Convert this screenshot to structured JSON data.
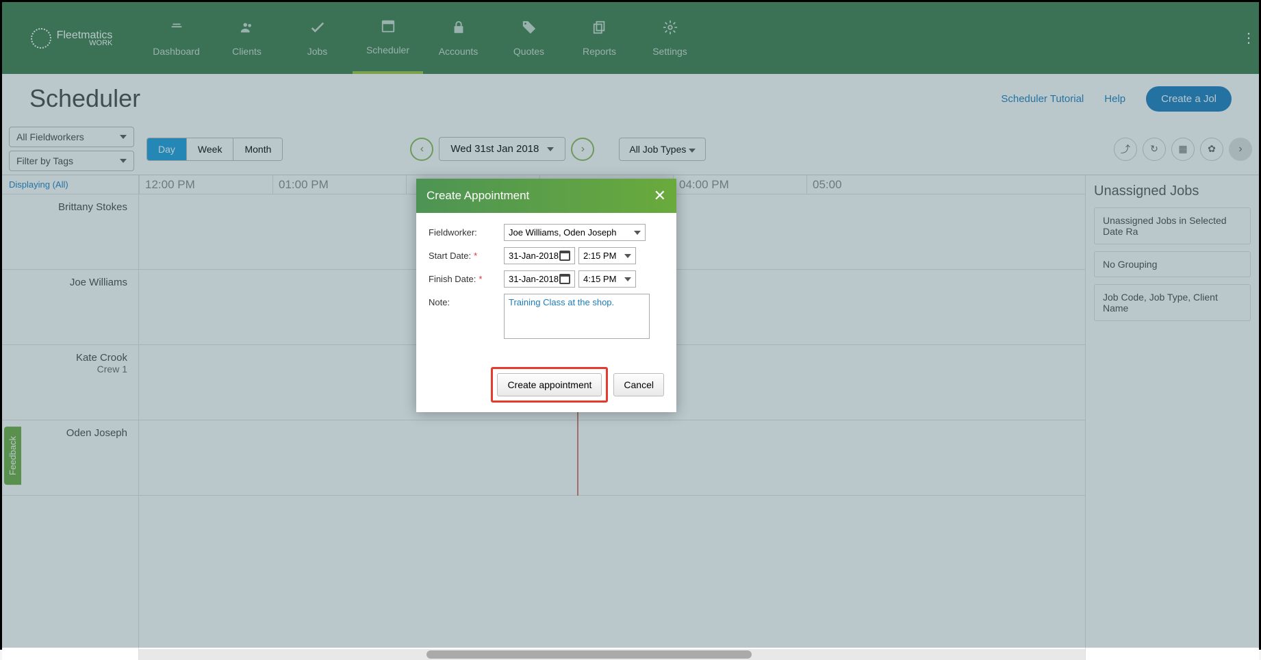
{
  "brand": {
    "name": "Fleetmatics",
    "sub": "WORK"
  },
  "nav": [
    {
      "label": "Dashboard"
    },
    {
      "label": "Clients"
    },
    {
      "label": "Jobs"
    },
    {
      "label": "Scheduler"
    },
    {
      "label": "Accounts"
    },
    {
      "label": "Quotes"
    },
    {
      "label": "Reports"
    },
    {
      "label": "Settings"
    }
  ],
  "page": {
    "title": "Scheduler",
    "tutorial": "Scheduler Tutorial",
    "help": "Help",
    "create_job": "Create a Jol"
  },
  "toolbar": {
    "fieldworkers": "All Fieldworkers",
    "tags": "Filter by Tags",
    "views": [
      "Day",
      "Week",
      "Month"
    ],
    "date": "Wed 31st Jan 2018",
    "job_types": "All Job Types"
  },
  "scheduler": {
    "displaying": "Displaying (All)",
    "times": [
      "12:00 PM",
      "01:00 PM",
      "",
      "",
      "04:00 PM",
      "05:00"
    ],
    "workers": [
      {
        "name": "Brittany Stokes",
        "sub": ""
      },
      {
        "name": "Joe Williams",
        "sub": ""
      },
      {
        "name": "Kate Crook",
        "sub": "Crew 1"
      },
      {
        "name": "Oden Joseph",
        "sub": ""
      }
    ]
  },
  "sidebar": {
    "title": "Unassigned Jobs",
    "range": "Unassigned Jobs in Selected Date Ra",
    "grouping": "No Grouping",
    "search": "Job Code, Job Type, Client Name"
  },
  "modal": {
    "title": "Create Appointment",
    "labels": {
      "fieldworker": "Fieldworker:",
      "start": "Start Date:",
      "finish": "Finish Date:",
      "note": "Note:"
    },
    "fieldworker": "Joe  Williams, Oden Joseph",
    "start_date": "31-Jan-2018",
    "start_time": "2:15 PM",
    "finish_date": "31-Jan-2018",
    "finish_time": "4:15 PM",
    "note": "Training Class at the shop.",
    "create_btn": "Create appointment",
    "cancel_btn": "Cancel"
  },
  "feedback": "Feedback"
}
